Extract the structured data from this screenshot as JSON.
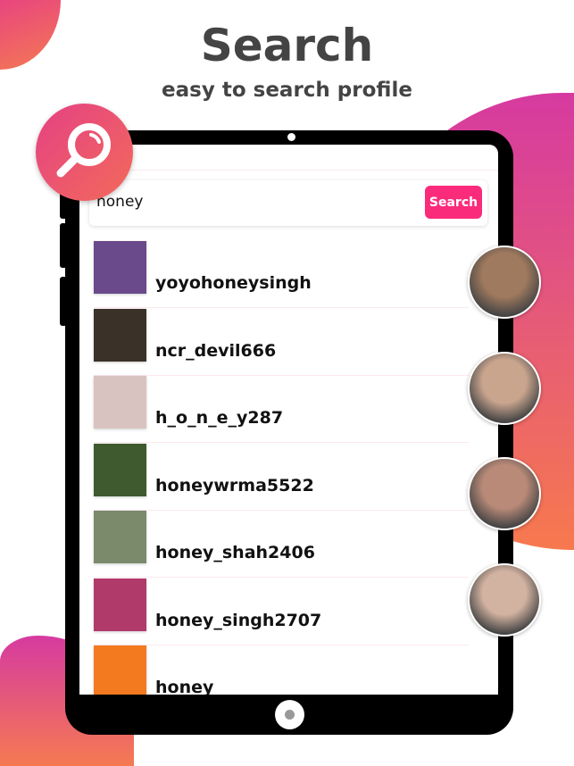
{
  "header": {
    "title": "Search",
    "subtitle": "easy to search profile"
  },
  "search": {
    "query": "honey",
    "button_label": "Search"
  },
  "colors": {
    "accent": "#fb2b7c",
    "gradient_top": "#d63aa0",
    "gradient_bottom": "#f7794e"
  },
  "results": [
    {
      "username": "yoyohoneysingh",
      "thumb": "#6a4a8a"
    },
    {
      "username": "ncr_devil666",
      "thumb": "#3a3228"
    },
    {
      "username": "h_o_n_e_y287",
      "thumb": "#d9c3c0"
    },
    {
      "username": "honeywrma5522",
      "thumb": "#3f5a2e"
    },
    {
      "username": "honey_shah2406",
      "thumb": "#7a8a6a"
    },
    {
      "username": "honey_singh2707",
      "thumb": "#b03a6a"
    },
    {
      "username": "honey",
      "thumb": "#f47a20"
    }
  ],
  "faces": [
    "#a07a5e",
    "#c9a58e",
    "#b98a78",
    "#d2b2a0"
  ]
}
